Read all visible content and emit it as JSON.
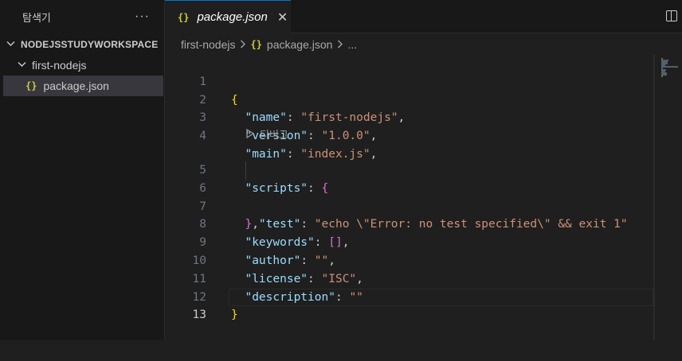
{
  "sidebar": {
    "title": "탐색기",
    "more": "···",
    "workspace": "NODEJSSTUDYWORKSPACE",
    "folder": "first-nodejs",
    "file": "package.json",
    "file_icon": "{}"
  },
  "tab": {
    "icon": "{}",
    "label": "package.json",
    "close": "✕"
  },
  "breadcrumb": {
    "folder": "first-nodejs",
    "icon": "{}",
    "file": "package.json",
    "more": "..."
  },
  "editor": {
    "line_numbers": [
      "1",
      "2",
      "3",
      "4",
      "5",
      "6",
      "7",
      "8",
      "9",
      "10",
      "11",
      "12",
      "13"
    ],
    "codelens": "디버그",
    "current_line": 13,
    "lines": [
      "{",
      "\"name\": \"first-nodejs\",",
      "\"version\": \"1.0.0\",",
      "\"main\": \"index.js\",",
      "\"scripts\": {",
      "\"test\": \"echo \\\"Error: no test specified\\\" && exit 1\"",
      "},",
      "\"keywords\": [],",
      "\"author\": \"\",",
      "\"license\": \"ISC\",",
      "\"description\": \"\"",
      "}",
      ""
    ]
  },
  "colors": {
    "accent": "#0078d4",
    "key": "#9cdcfe",
    "string": "#ce9178",
    "bracket_level1": "#ffd700",
    "bracket_level2": "#da70d6",
    "json_icon": "#cbcb41"
  }
}
